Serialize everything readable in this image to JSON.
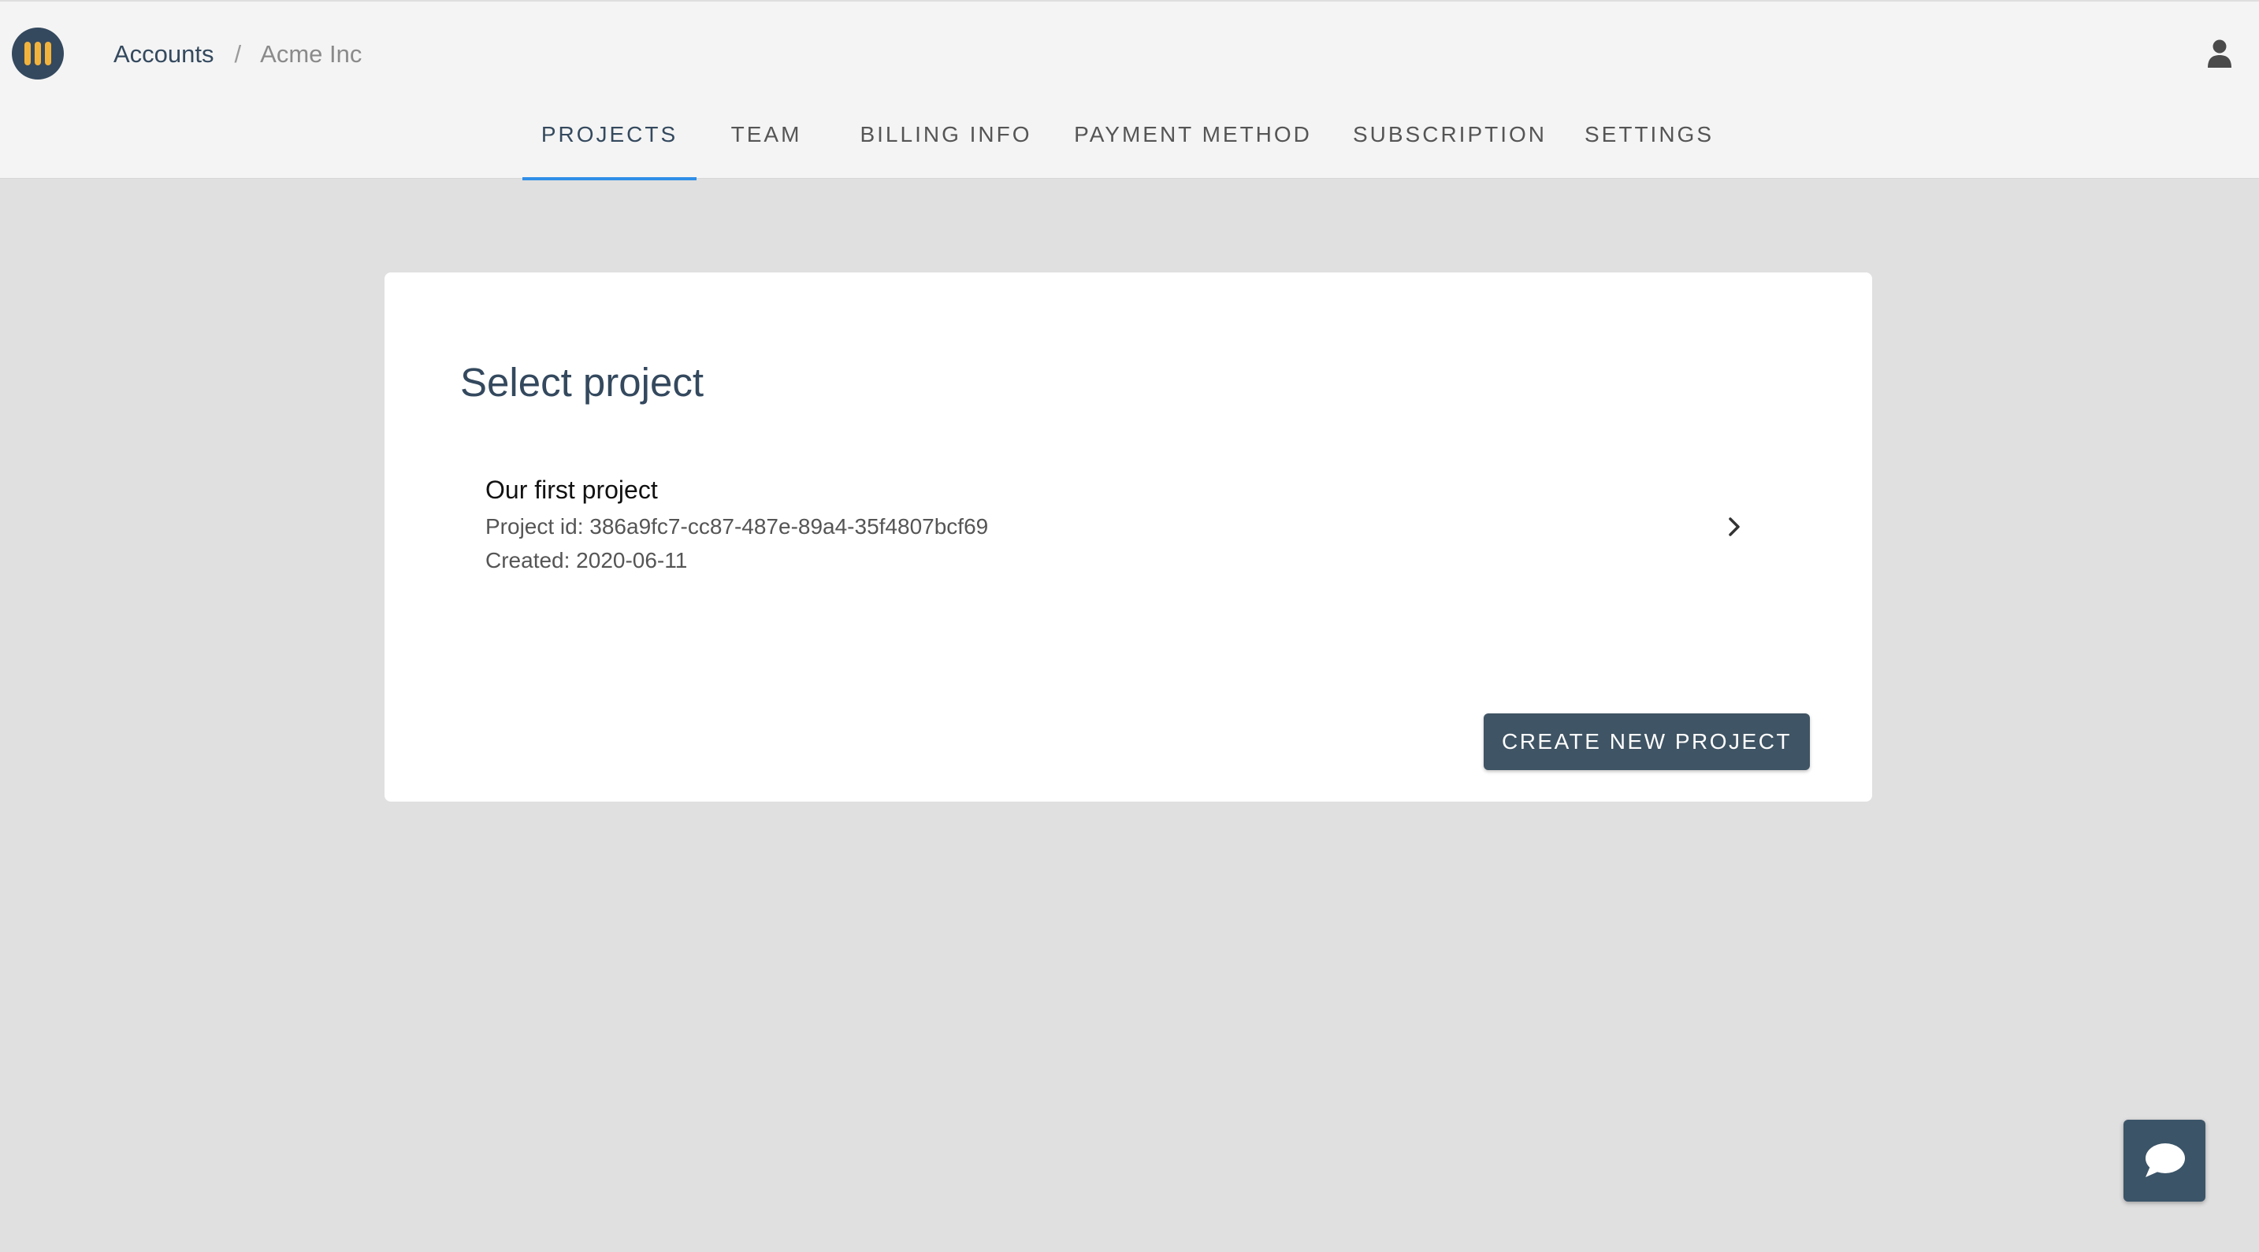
{
  "header": {
    "breadcrumb": {
      "accounts": "Accounts",
      "separator": "/",
      "current": "Acme Inc"
    },
    "logo_icon": "bars-logo-icon",
    "user_icon": "user-icon"
  },
  "tabs": [
    {
      "label": "PROJECTS",
      "active": true
    },
    {
      "label": "TEAM",
      "active": false
    },
    {
      "label": "BILLING INFO",
      "active": false
    },
    {
      "label": "PAYMENT METHOD",
      "active": false
    },
    {
      "label": "SUBSCRIPTION",
      "active": false
    },
    {
      "label": "SETTINGS",
      "active": false
    }
  ],
  "main": {
    "title": "Select project",
    "projects": [
      {
        "name": "Our first project",
        "id_text": "Project id: 386a9fc7-cc87-487e-89a4-35f4807bcf69",
        "created_text": "Created: 2020-06-11",
        "chevron_icon": "chevron-right-icon"
      }
    ],
    "create_button_label": "CREATE NEW PROJECT"
  },
  "chat": {
    "icon": "chat-bubble-icon"
  },
  "colors": {
    "primary_dark": "#34495e",
    "accent_blue": "#2f8ee8",
    "logo_yellow": "#f2b33d",
    "button_bg": "#3f5464",
    "page_bg": "#e0e0e0",
    "header_bg": "#f4f4f4"
  }
}
